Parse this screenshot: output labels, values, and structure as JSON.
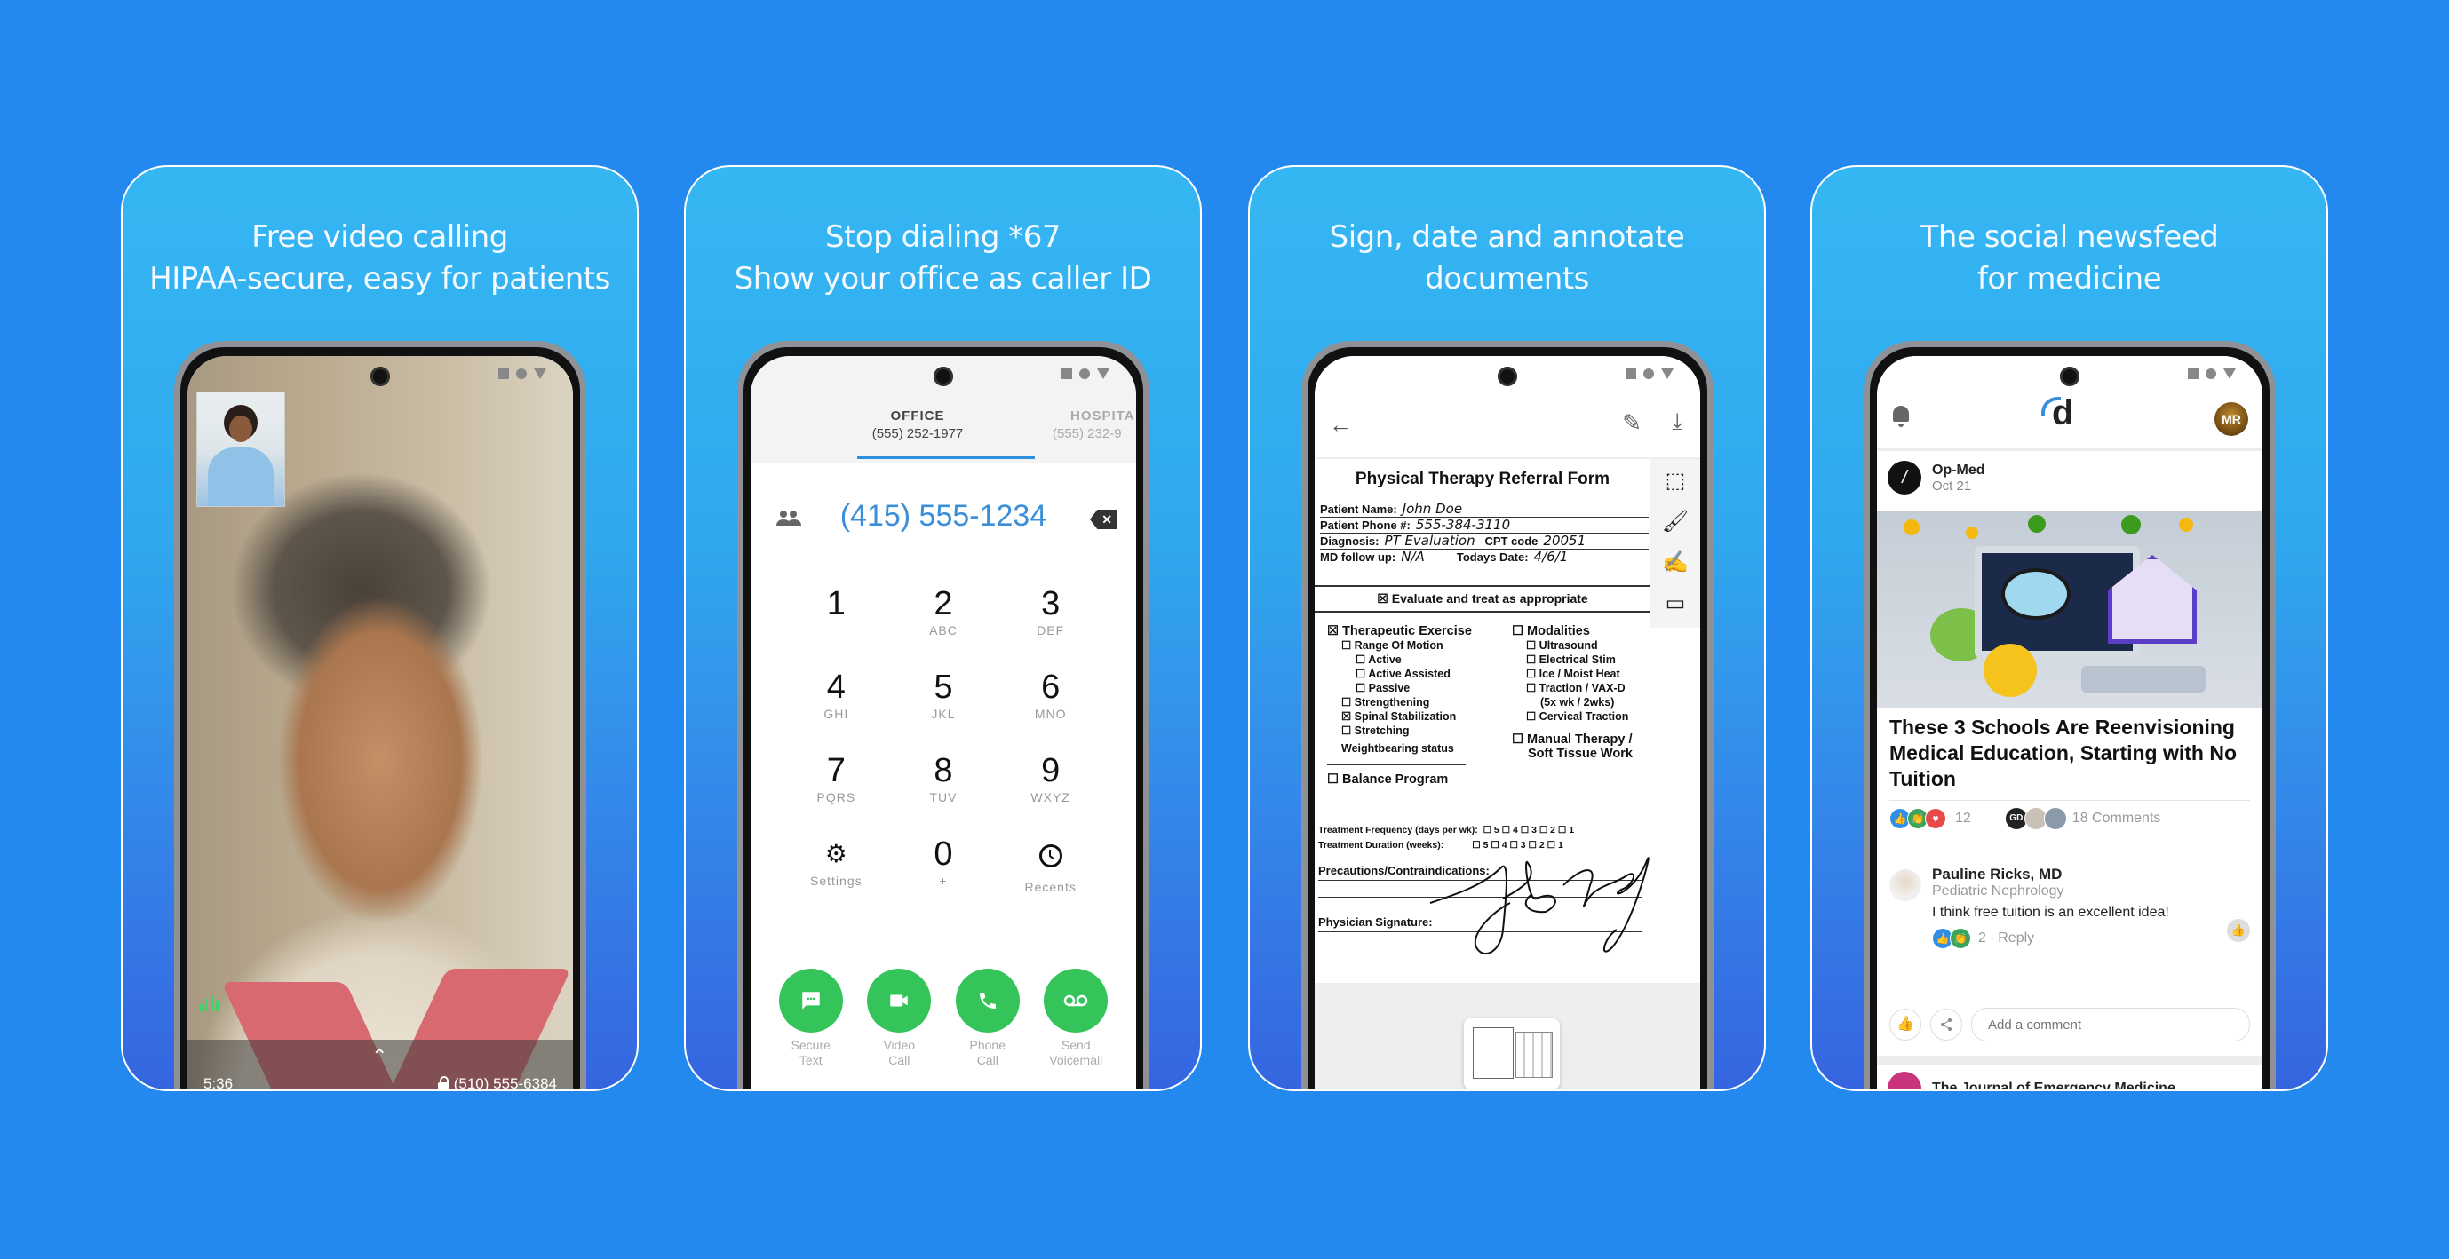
{
  "colors": {
    "background": "#2389ee",
    "accent_blue": "#3b8fd9",
    "action_green": "#34c45a",
    "end_call_red": "#ee3b2f"
  },
  "panels": [
    {
      "title_lines": [
        "Free video calling",
        "HIPAA-secure, easy for patients"
      ],
      "screen": {
        "type": "video-call",
        "call_timer": "5:36",
        "caller_number": "(510) 555-6384",
        "icons": [
          "lock-icon",
          "chevron-up-icon",
          "audio-level-icon"
        ]
      }
    },
    {
      "title_lines": [
        "Stop dialing *67",
        "Show your office as caller ID"
      ],
      "screen": {
        "type": "dialer",
        "tabs": [
          {
            "label": "OFFICE",
            "number": "(555) 252-1977",
            "active": true
          },
          {
            "label": "HOSPITA",
            "number": "(555) 232-9",
            "active": false
          }
        ],
        "dialed_number": "(415) 555-1234",
        "keys": [
          {
            "digit": "1",
            "letters": ""
          },
          {
            "digit": "2",
            "letters": "ABC"
          },
          {
            "digit": "3",
            "letters": "DEF"
          },
          {
            "digit": "4",
            "letters": "GHI"
          },
          {
            "digit": "5",
            "letters": "JKL"
          },
          {
            "digit": "6",
            "letters": "MNO"
          },
          {
            "digit": "7",
            "letters": "PQRS"
          },
          {
            "digit": "8",
            "letters": "TUV"
          },
          {
            "digit": "9",
            "letters": "WXYZ"
          },
          {
            "digit": "⚙",
            "letters": "Settings"
          },
          {
            "digit": "0",
            "letters": "+"
          },
          {
            "digit": "",
            "letters": "Recents"
          }
        ],
        "actions": [
          {
            "line1": "Secure",
            "line2": "Text",
            "icon": "message-icon"
          },
          {
            "line1": "Video",
            "line2": "Call",
            "icon": "videocam-icon"
          },
          {
            "line1": "Phone",
            "line2": "Call",
            "icon": "phone-icon"
          },
          {
            "line1": "Send",
            "line2": "Voicemail",
            "icon": "voicemail-icon"
          }
        ]
      }
    },
    {
      "title_lines": [
        "Sign, date and annotate",
        "documents"
      ],
      "screen": {
        "type": "document",
        "form_title": "Physical Therapy Referral Form",
        "fields": {
          "patient_name_label": "Patient Name:",
          "patient_name": "John Doe",
          "patient_phone_label": "Patient Phone #:",
          "patient_phone": "555-384-3110",
          "diagnosis_label": "Diagnosis:",
          "diagnosis": "PT Evaluation",
          "cpt_label": "CPT code",
          "cpt": "20051",
          "followup_label": "MD follow up:",
          "followup": "N/A",
          "date_label": "Todays Date:",
          "date": "4/6/1"
        },
        "evaluate": "☒ Evaluate and treat as appropriate",
        "left_column": [
          {
            "text": "☒ Therapeutic Exercise",
            "level": 0
          },
          {
            "text": "☐ Range Of Motion",
            "level": 1
          },
          {
            "text": "☐ Active",
            "level": 2
          },
          {
            "text": "☐ Active Assisted",
            "level": 2
          },
          {
            "text": "☐ Passive",
            "level": 2
          },
          {
            "text": "☐ Strengthening",
            "level": 1
          },
          {
            "text": "☒ Spinal Stabilization",
            "level": 1
          },
          {
            "text": "☐ Stretching",
            "level": 1
          },
          {
            "text": "Weightbearing status",
            "level": 1
          },
          {
            "text": "☐ Balance Program",
            "level": 0
          }
        ],
        "right_column": [
          {
            "text": "☐ Modalities",
            "level": 0
          },
          {
            "text": "☐ Ultrasound",
            "level": 1
          },
          {
            "text": "☐ Electrical Stim",
            "level": 1
          },
          {
            "text": "☐ Ice / Moist Heat",
            "level": 1
          },
          {
            "text": "☐ Traction / VAX-D",
            "level": 1
          },
          {
            "text": "(5x wk / 2wks)",
            "level": 2
          },
          {
            "text": "☐ Cervical Traction",
            "level": 1
          },
          {
            "text": "☐ Manual Therapy /",
            "level": 0
          },
          {
            "text": "Soft Tissue Work",
            "level": 0
          }
        ],
        "frequency_label": "Treatment  Frequency (days per wk):",
        "duration_label": "Treatment Duration (weeks):",
        "scale_options": "☐ 5  ☐ 4  ☐ 3  ☐ 2  ☐ 1",
        "precautions_label": "Precautions/Contraindications:",
        "signature_label": "Physician Signature:",
        "toolbar_icons": [
          "text-box-icon",
          "brush-icon",
          "signature-icon",
          "calendar-icon"
        ]
      }
    },
    {
      "title_lines": [
        "The social newsfeed",
        "for medicine"
      ],
      "screen": {
        "type": "newsfeed",
        "app_logo": "d",
        "user_initials": "MR",
        "post": {
          "source": "Op-Med",
          "date": "Oct 21",
          "headline": "These 3 Schools Are Reenvisioning Medical Education, Starting with No Tuition",
          "reaction_count": "12",
          "commenter_initials": "GD",
          "comments_count": "18 Comments"
        },
        "comment": {
          "author": "Pauline Ricks, MD",
          "specialty": "Pediatric Nephrology",
          "text": "I think free tuition is an excellent idea!",
          "reaction_count": "2",
          "reply_label": "Reply"
        },
        "comment_placeholder": "Add a comment",
        "next_post_source": "The Journal of Emergency Medicine"
      }
    }
  ]
}
